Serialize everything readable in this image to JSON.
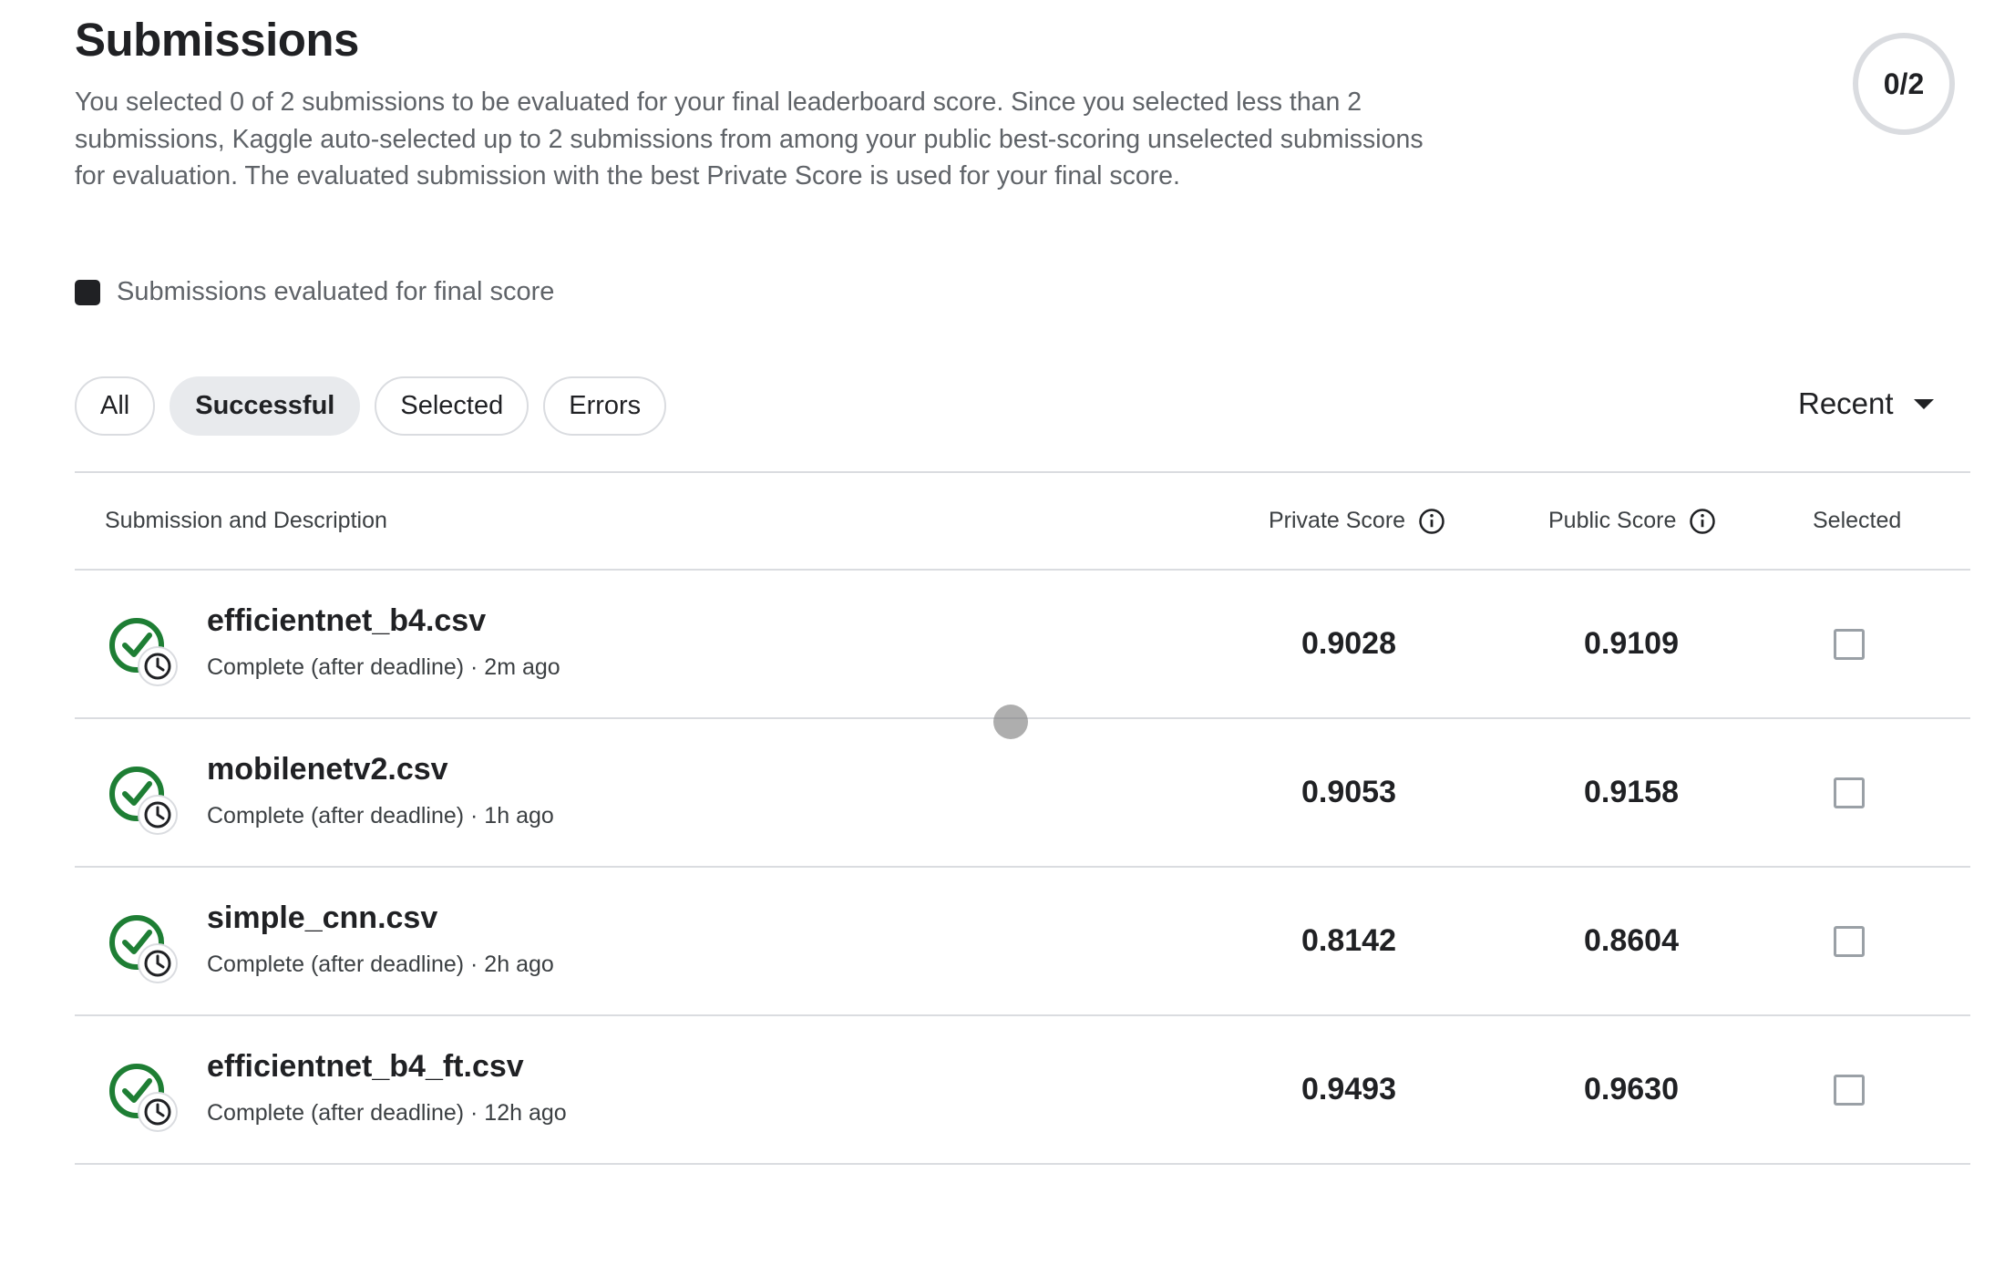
{
  "header": {
    "title": "Submissions",
    "description": "You selected 0 of 2 submissions to be evaluated for your final leaderboard score. Since you selected less than 2 submissions, Kaggle auto-selected up to 2 submissions from among your public best-scoring unselected submissions for evaluation. The evaluated submission with the best Private Score is used for your final score.",
    "counter": "0/2"
  },
  "legend": {
    "label": "Submissions evaluated for final score"
  },
  "filters": {
    "chips": [
      {
        "label": "All",
        "active": false
      },
      {
        "label": "Successful",
        "active": true
      },
      {
        "label": "Selected",
        "active": false
      },
      {
        "label": "Errors",
        "active": false
      }
    ],
    "sort_label": "Recent"
  },
  "table": {
    "headers": {
      "submission": "Submission and Description",
      "private": "Private Score",
      "public": "Public Score",
      "selected": "Selected"
    },
    "rows": [
      {
        "name": "efficientnet_b4.csv",
        "meta": "Complete (after deadline) · 2m ago",
        "private": "0.9028",
        "public": "0.9109",
        "selected": false
      },
      {
        "name": "mobilenetv2.csv",
        "meta": "Complete (after deadline) · 1h ago",
        "private": "0.9053",
        "public": "0.9158",
        "selected": false
      },
      {
        "name": "simple_cnn.csv",
        "meta": "Complete (after deadline) · 2h ago",
        "private": "0.8142",
        "public": "0.8604",
        "selected": false
      },
      {
        "name": "efficientnet_b4_ft.csv",
        "meta": "Complete (after deadline) · 12h ago",
        "private": "0.9493",
        "public": "0.9630",
        "selected": false
      }
    ]
  },
  "colors": {
    "success": "#1e7e34",
    "border": "#dadce0",
    "text": "#202124",
    "muted": "#5f6368"
  },
  "icons": {
    "status": "check-circle-clock-icon",
    "info": "info-icon",
    "sort": "caret-down-icon"
  }
}
